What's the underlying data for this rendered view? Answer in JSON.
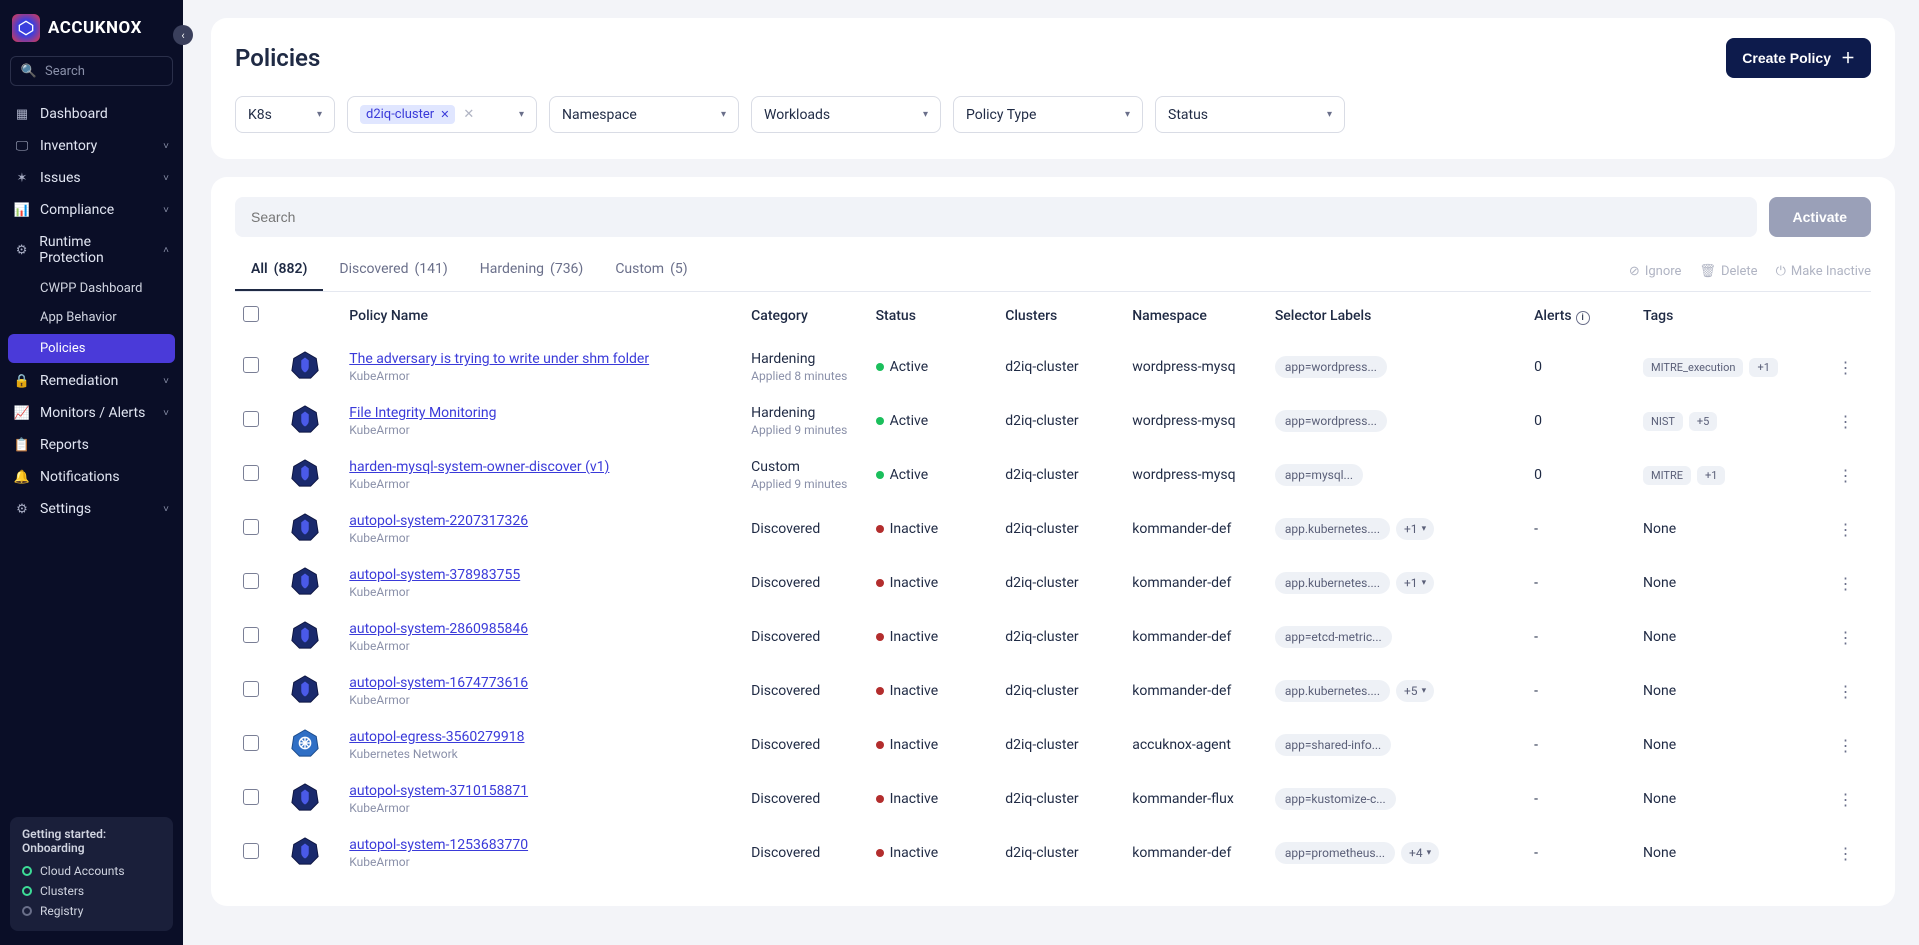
{
  "brand": "ACCUKNOX",
  "search_placeholder": "Search",
  "sidebar": {
    "items": [
      {
        "label": "Dashboard",
        "icon": "▦"
      },
      {
        "label": "Inventory",
        "icon": "🖵",
        "expandable": true
      },
      {
        "label": "Issues",
        "icon": "✶",
        "expandable": true
      },
      {
        "label": "Compliance",
        "icon": "📊",
        "expandable": true
      },
      {
        "label": "Runtime Protection",
        "icon": "⚙",
        "expandable": true,
        "expanded": true,
        "children": [
          {
            "label": "CWPP Dashboard"
          },
          {
            "label": "App Behavior"
          },
          {
            "label": "Policies",
            "active": true
          }
        ]
      },
      {
        "label": "Remediation",
        "icon": "🔒",
        "expandable": true
      },
      {
        "label": "Monitors / Alerts",
        "icon": "📈",
        "expandable": true
      },
      {
        "label": "Reports",
        "icon": "📋"
      },
      {
        "label": "Notifications",
        "icon": "🔔"
      },
      {
        "label": "Settings",
        "icon": "⚙",
        "expandable": true
      }
    ],
    "onboarding": {
      "title": "Getting started: Onboarding",
      "steps": [
        {
          "label": "Cloud Accounts",
          "done": true
        },
        {
          "label": "Clusters",
          "done": true
        },
        {
          "label": "Registry",
          "done": false
        }
      ]
    }
  },
  "page": {
    "title": "Policies",
    "create_btn": "Create Policy",
    "filters": [
      {
        "label": "K8s",
        "type": "dropdown"
      },
      {
        "label": "",
        "type": "chip-select",
        "chip": "d2iq-cluster"
      },
      {
        "label": "Namespace",
        "type": "dropdown"
      },
      {
        "label": "Workloads",
        "type": "dropdown"
      },
      {
        "label": "Policy Type",
        "type": "dropdown"
      },
      {
        "label": "Status",
        "type": "dropdown"
      }
    ],
    "table_search_placeholder": "Search",
    "activate_btn": "Activate",
    "tabs": [
      {
        "label": "All",
        "count": "(882)",
        "active": true
      },
      {
        "label": "Discovered",
        "count": "(141)"
      },
      {
        "label": "Hardening",
        "count": "(736)"
      },
      {
        "label": "Custom",
        "count": "(5)"
      }
    ],
    "tab_actions": [
      {
        "label": "Ignore",
        "icon": "⊘"
      },
      {
        "label": "Delete",
        "icon": "🗑"
      },
      {
        "label": "Make Inactive",
        "icon": "⏻"
      }
    ],
    "columns": [
      "Policy Name",
      "Category",
      "Status",
      "Clusters",
      "Namespace",
      "Selector Labels",
      "Alerts",
      "Tags"
    ],
    "rows": [
      {
        "name": "The adversary is trying to write under shm folder",
        "tool": "KubeArmor",
        "category": "Hardening",
        "applied": "Applied 8 minutes",
        "status": "Active",
        "cluster": "d2iq-cluster",
        "namespace": "wordpress-mysq",
        "labels": "app=wordpress...",
        "labels_more": "",
        "alerts": "0",
        "tags": [
          "MITRE_execution",
          "+1"
        ],
        "icon": "kube"
      },
      {
        "name": "File Integrity Monitoring",
        "tool": "KubeArmor",
        "category": "Hardening",
        "applied": "Applied 9 minutes",
        "status": "Active",
        "cluster": "d2iq-cluster",
        "namespace": "wordpress-mysq",
        "labels": "app=wordpress...",
        "labels_more": "",
        "alerts": "0",
        "tags": [
          "NIST",
          "+5"
        ],
        "icon": "kube"
      },
      {
        "name": "harden-mysql-system-owner-discover (v1)",
        "tool": "KubeArmor",
        "category": "Custom",
        "applied": "Applied 9 minutes",
        "status": "Active",
        "cluster": "d2iq-cluster",
        "namespace": "wordpress-mysq",
        "labels": "app=mysql...",
        "labels_more": "",
        "alerts": "0",
        "tags": [
          "MITRE",
          "+1"
        ],
        "icon": "kube"
      },
      {
        "name": "autopol-system-2207317326",
        "tool": "KubeArmor",
        "category": "Discovered",
        "applied": "",
        "status": "Inactive",
        "cluster": "d2iq-cluster",
        "namespace": "kommander-def",
        "labels": "app.kubernetes....",
        "labels_more": "+1",
        "alerts": "-",
        "tags": [
          "None"
        ],
        "icon": "kube"
      },
      {
        "name": "autopol-system-378983755",
        "tool": "KubeArmor",
        "category": "Discovered",
        "applied": "",
        "status": "Inactive",
        "cluster": "d2iq-cluster",
        "namespace": "kommander-def",
        "labels": "app.kubernetes....",
        "labels_more": "+1",
        "alerts": "-",
        "tags": [
          "None"
        ],
        "icon": "kube"
      },
      {
        "name": "autopol-system-2860985846",
        "tool": "KubeArmor",
        "category": "Discovered",
        "applied": "",
        "status": "Inactive",
        "cluster": "d2iq-cluster",
        "namespace": "kommander-def",
        "labels": "app=etcd-metric...",
        "labels_more": "",
        "alerts": "-",
        "tags": [
          "None"
        ],
        "icon": "kube"
      },
      {
        "name": "autopol-system-1674773616",
        "tool": "KubeArmor",
        "category": "Discovered",
        "applied": "",
        "status": "Inactive",
        "cluster": "d2iq-cluster",
        "namespace": "kommander-def",
        "labels": "app.kubernetes....",
        "labels_more": "+5",
        "alerts": "-",
        "tags": [
          "None"
        ],
        "icon": "kube"
      },
      {
        "name": "autopol-egress-3560279918",
        "tool": "Kubernetes Network",
        "category": "Discovered",
        "applied": "",
        "status": "Inactive",
        "cluster": "d2iq-cluster",
        "namespace": "accuknox-agent",
        "labels": "app=shared-info...",
        "labels_more": "",
        "alerts": "-",
        "tags": [
          "None"
        ],
        "icon": "k8s"
      },
      {
        "name": "autopol-system-3710158871",
        "tool": "KubeArmor",
        "category": "Discovered",
        "applied": "",
        "status": "Inactive",
        "cluster": "d2iq-cluster",
        "namespace": "kommander-flux",
        "labels": "app=kustomize-c...",
        "labels_more": "",
        "alerts": "-",
        "tags": [
          "None"
        ],
        "icon": "kube"
      },
      {
        "name": "autopol-system-1253683770",
        "tool": "KubeArmor",
        "category": "Discovered",
        "applied": "",
        "status": "Inactive",
        "cluster": "d2iq-cluster",
        "namespace": "kommander-def",
        "labels": "app=prometheus...",
        "labels_more": "+4",
        "alerts": "-",
        "tags": [
          "None"
        ],
        "icon": "kube"
      }
    ]
  }
}
